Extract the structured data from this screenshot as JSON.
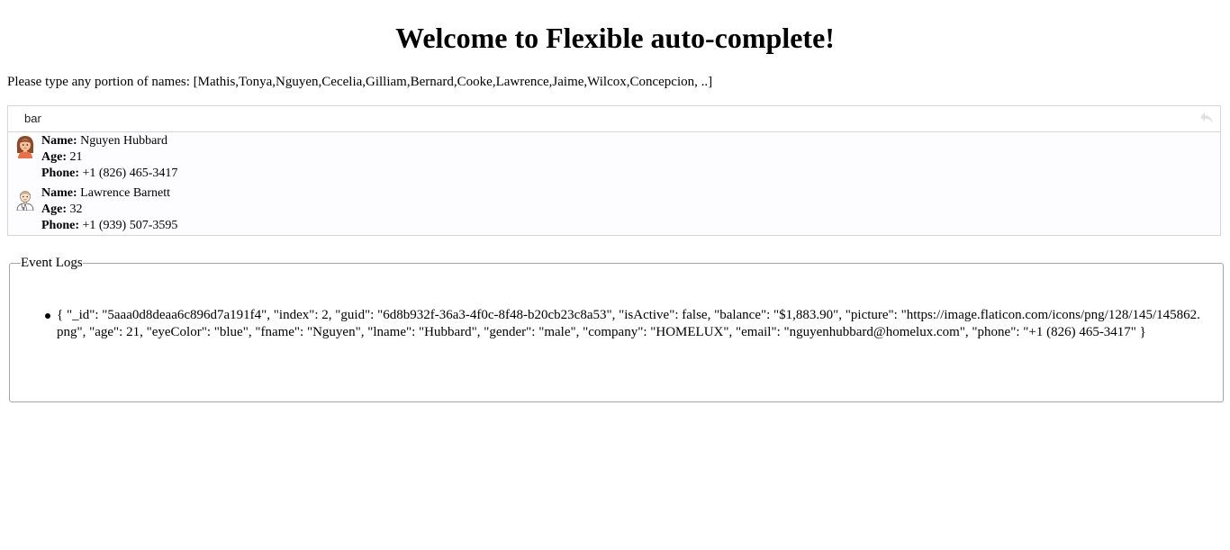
{
  "header": {
    "title": "Welcome to Flexible auto-complete!"
  },
  "instructions": {
    "text": "Please type any portion of names: [Mathis,Tonya,Nguyen,Cecelia,Gilliam,Bernard,Cooke,Lawrence,Jaime,Wilcox,Concepcion, ..]"
  },
  "autocomplete": {
    "input_value": "bar",
    "clear_icon": "undo-arrow-icon",
    "labels": {
      "name": "Name:",
      "age": "Age:",
      "phone": "Phone:"
    },
    "results": [
      {
        "name": "Nguyen Hubbard",
        "age": "21",
        "phone": "+1 (826) 465-3417",
        "avatar_icon": "female-avatar-icon"
      },
      {
        "name": "Lawrence Barnett",
        "age": "32",
        "phone": "+1 (939) 507-3595",
        "avatar_icon": "male-doctor-avatar-icon"
      }
    ]
  },
  "event_logs": {
    "legend": "Event Logs",
    "entries": [
      "{ \"_id\": \"5aaa0d8deaa6c896d7a191f4\", \"index\": 2, \"guid\": \"6d8b932f-36a3-4f0c-8f48-b20cb23c8a53\", \"isActive\": false, \"balance\": \"$1,883.90\", \"picture\": \"https://image.flaticon.com/icons/png/128/145/145862.png\", \"age\": 21, \"eyeColor\": \"blue\", \"fname\": \"Nguyen\", \"lname\": \"Hubbard\", \"gender\": \"male\", \"company\": \"HOMELUX\", \"email\": \"nguyenhubbard@homelux.com\", \"phone\": \"+1 (826) 465-3417\" }"
    ]
  },
  "colors": {
    "border": "#d6d6d6",
    "fieldset_border": "#a6a6a6",
    "results_bg": "#fdfdff"
  }
}
